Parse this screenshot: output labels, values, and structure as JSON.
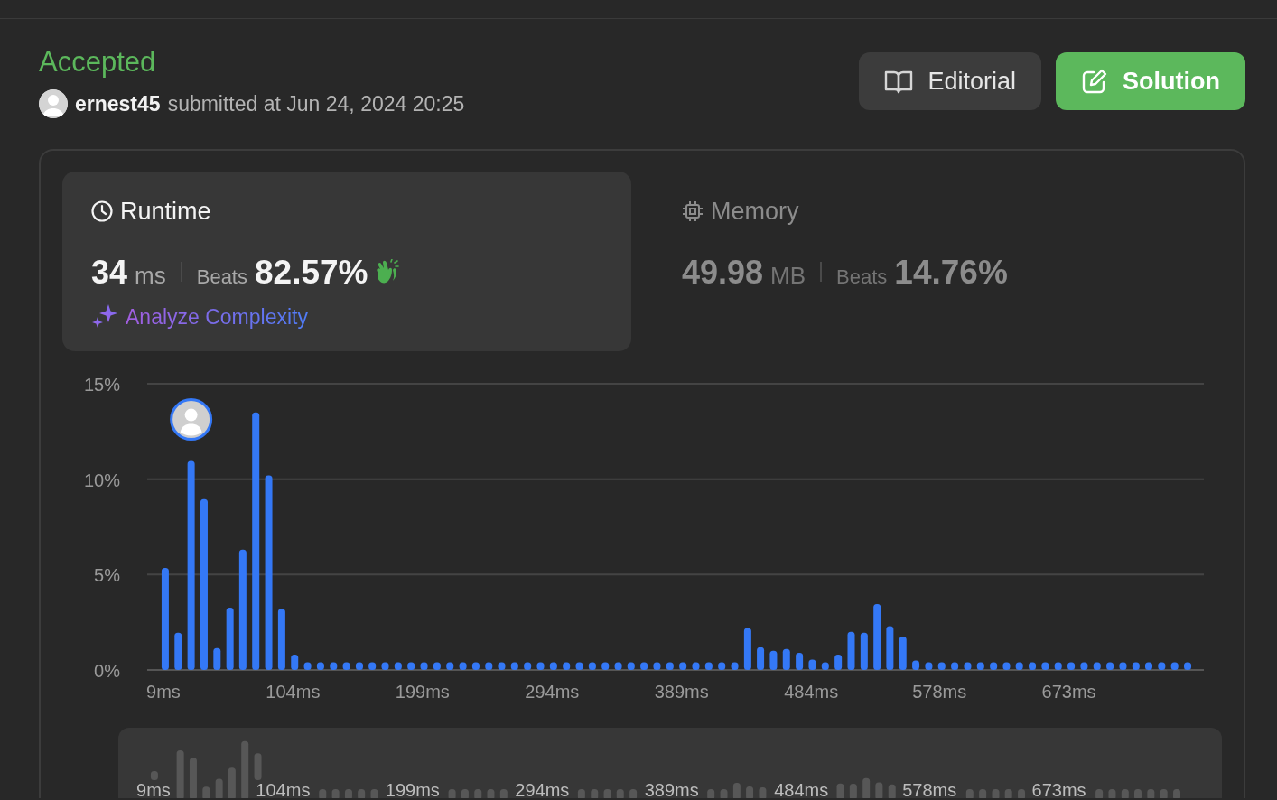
{
  "status": "Accepted",
  "user": {
    "name": "ernest45",
    "submitted": "submitted at Jun 24, 2024 20:25"
  },
  "buttons": [
    {
      "kind": "editorial",
      "label": "Editorial"
    },
    {
      "kind": "solution",
      "label": "Solution"
    }
  ],
  "panels": [
    {
      "kind": "runtime",
      "title": "Runtime",
      "selected": true,
      "value": "34",
      "unit": "ms",
      "beats_label": "Beats",
      "beats": "82.57%",
      "link": "Analyze Complexity"
    },
    {
      "kind": "memory",
      "title": "Memory",
      "selected": false,
      "value": "49.98",
      "unit": "MB",
      "beats_label": "Beats",
      "beats": "14.76%"
    }
  ],
  "chart_data": {
    "type": "bar",
    "x": [
      9,
      18.5,
      28,
      37.5,
      47,
      56.5,
      65.9,
      75.4,
      84.9,
      94.4,
      103.9,
      113.4,
      122.9,
      132.4,
      141.9,
      151.4,
      160.8,
      170.3,
      179.8,
      189.3,
      198.8,
      208.3,
      217.8,
      227.3,
      236.8,
      246.3,
      255.7,
      265.2,
      274.7,
      284.2,
      293.7,
      303.2,
      312.7,
      322.2,
      331.7,
      341.2,
      350.6,
      360.1,
      369.6,
      379.1,
      388.6,
      398.1,
      407.6,
      417.1,
      426.6,
      436.1,
      445.5,
      455,
      464.5,
      474,
      483.5,
      493,
      502.5,
      512,
      521.5,
      531,
      540.4,
      549.9,
      559.4,
      568.9,
      578.4,
      587.9,
      597.4,
      606.9,
      616.4,
      625.9,
      635.3,
      644.8,
      654.3,
      663.8,
      673.3,
      682.8,
      692.3,
      701.8,
      711.3,
      720.8,
      730.2,
      739.7,
      749.2,
      758.7
    ],
    "xlim": [
      -4.2,
      770.6
    ],
    "values": [
      5.35,
      1.95,
      10.95,
      8.95,
      1.15,
      3.27,
      6.3,
      13.5,
      10.2,
      3.2,
      0.8,
      0.4,
      0.4,
      0.4,
      0.4,
      0.4,
      0.4,
      0.4,
      0.4,
      0.4,
      0.4,
      0.4,
      0.4,
      0.4,
      0.4,
      0.4,
      0.4,
      0.4,
      0.4,
      0.4,
      0.4,
      0.4,
      0.4,
      0.4,
      0.4,
      0.4,
      0.4,
      0.4,
      0.4,
      0.4,
      0.4,
      0.4,
      0.4,
      0.4,
      0.4,
      2.2,
      1.2,
      1.0,
      1.1,
      0.9,
      0.55,
      0.4,
      0.8,
      2.0,
      1.95,
      3.45,
      2.3,
      1.75,
      0.5,
      0.4,
      0.4,
      0.4,
      0.4,
      0.4,
      0.4,
      0.4,
      0.4,
      0.4,
      0.4,
      0.4,
      0.4,
      0.4,
      0.4,
      0.4,
      0.4,
      0.4,
      0.4,
      0.4,
      0.4,
      0.4
    ],
    "ylim": [
      0,
      15
    ],
    "yticks": [
      {
        "value": 0,
        "label": "0%"
      },
      {
        "value": 5,
        "label": "5%"
      },
      {
        "value": 10,
        "label": "10%"
      },
      {
        "value": 15,
        "label": "15%"
      }
    ],
    "xticks": [
      {
        "value": 9,
        "label": "9ms"
      },
      {
        "value": 104,
        "label": "104ms"
      },
      {
        "value": 199,
        "label": "199ms"
      },
      {
        "value": 294,
        "label": "294ms"
      },
      {
        "value": 389,
        "label": "389ms"
      },
      {
        "value": 484,
        "label": "484ms"
      },
      {
        "value": 578,
        "label": "578ms"
      },
      {
        "value": 673,
        "label": "673ms"
      }
    ]
  },
  "overview": {
    "labels": [
      "9ms",
      "104ms",
      "199ms",
      "294ms",
      "389ms",
      "484ms",
      "578ms",
      "673ms"
    ]
  }
}
